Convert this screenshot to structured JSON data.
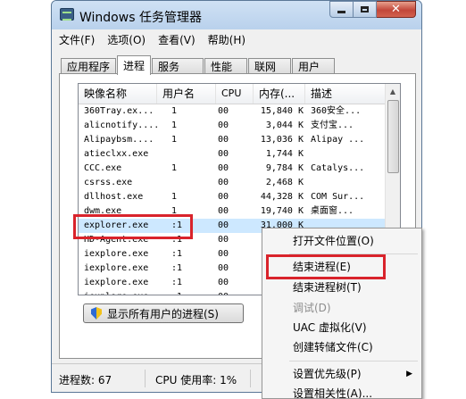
{
  "window": {
    "title": "Windows 任务管理器",
    "close_glyph": "✕"
  },
  "menu": [
    "文件(F)",
    "选项(O)",
    "查看(V)",
    "帮助(H)"
  ],
  "tabs": [
    {
      "label": "应用程序",
      "active": false
    },
    {
      "label": "进程",
      "active": true
    },
    {
      "label": "服务",
      "active": false
    },
    {
      "label": "性能",
      "active": false
    },
    {
      "label": "联网",
      "active": false
    },
    {
      "label": "用户",
      "active": false
    }
  ],
  "columns": [
    "映像名称",
    "用户名",
    "CPU",
    "内存(...",
    "描述"
  ],
  "processes": [
    {
      "name": "360Tray.ex...",
      "user": "1",
      "cpu": "00",
      "mem": "15,840 K",
      "desc": "360安全..."
    },
    {
      "name": "alicnotify....",
      "user": "1",
      "cpu": "00",
      "mem": "3,044 K",
      "desc": "支付宝..."
    },
    {
      "name": "Alipaybsm....",
      "user": "1",
      "cpu": "00",
      "mem": "13,036 K",
      "desc": "Alipay ..."
    },
    {
      "name": "atieclxx.exe",
      "user": "",
      "cpu": "00",
      "mem": "1,744 K",
      "desc": ""
    },
    {
      "name": "CCC.exe",
      "user": "1",
      "cpu": "00",
      "mem": "9,784 K",
      "desc": "Catalys..."
    },
    {
      "name": "csrss.exe",
      "user": "",
      "cpu": "00",
      "mem": "2,468 K",
      "desc": ""
    },
    {
      "name": "dllhost.exe",
      "user": "1",
      "cpu": "00",
      "mem": "44,328 K",
      "desc": "COM Sur..."
    },
    {
      "name": "dwm.exe",
      "user": "1",
      "cpu": "00",
      "mem": "19,740 K",
      "desc": "桌面窗..."
    },
    {
      "name": "explorer.exe",
      "user": ":1",
      "cpu": "00",
      "mem": "31,000 K",
      "desc": ""
    },
    {
      "name": "HD-Agent.exe",
      "user": ":1",
      "cpu": "00",
      "mem": "",
      "desc": ""
    },
    {
      "name": "iexplore.exe",
      "user": ":1",
      "cpu": "00",
      "mem": "1",
      "desc": ""
    },
    {
      "name": "iexplore.exe",
      "user": ":1",
      "cpu": "00",
      "mem": "7",
      "desc": ""
    },
    {
      "name": "iexplore.exe",
      "user": ":1",
      "cpu": "00",
      "mem": "1",
      "desc": ""
    },
    {
      "name": "iexplore.exe",
      "user": ":1",
      "cpu": "00",
      "mem": "9",
      "desc": ""
    },
    {
      "name": "iexplore.exe",
      "user": ":1",
      "cpu": "00",
      "mem": "",
      "desc": ""
    }
  ],
  "selected_process_index": 8,
  "show_all_button": "显示所有用户的进程(S)",
  "status": {
    "process_count": "进程数: 67",
    "cpu_usage": "CPU 使用率: 1%"
  },
  "context_menu": {
    "items": [
      {
        "label": "打开文件位置(O)",
        "disabled": false
      },
      {
        "label": "结束进程(E)",
        "disabled": false
      },
      {
        "label": "结束进程树(T)",
        "disabled": false
      },
      {
        "label": "调试(D)",
        "disabled": true
      },
      {
        "label": "UAC 虚拟化(V)",
        "disabled": false
      },
      {
        "label": "创建转储文件(C)",
        "disabled": false
      },
      {
        "label": "设置优先级(P)",
        "disabled": false,
        "submenu": true
      },
      {
        "label": "设置相关性(A)...",
        "disabled": false
      }
    ],
    "submenu_arrow": "▶"
  },
  "highlight_color": "#d9232b",
  "selection_color": "#cde8ff"
}
